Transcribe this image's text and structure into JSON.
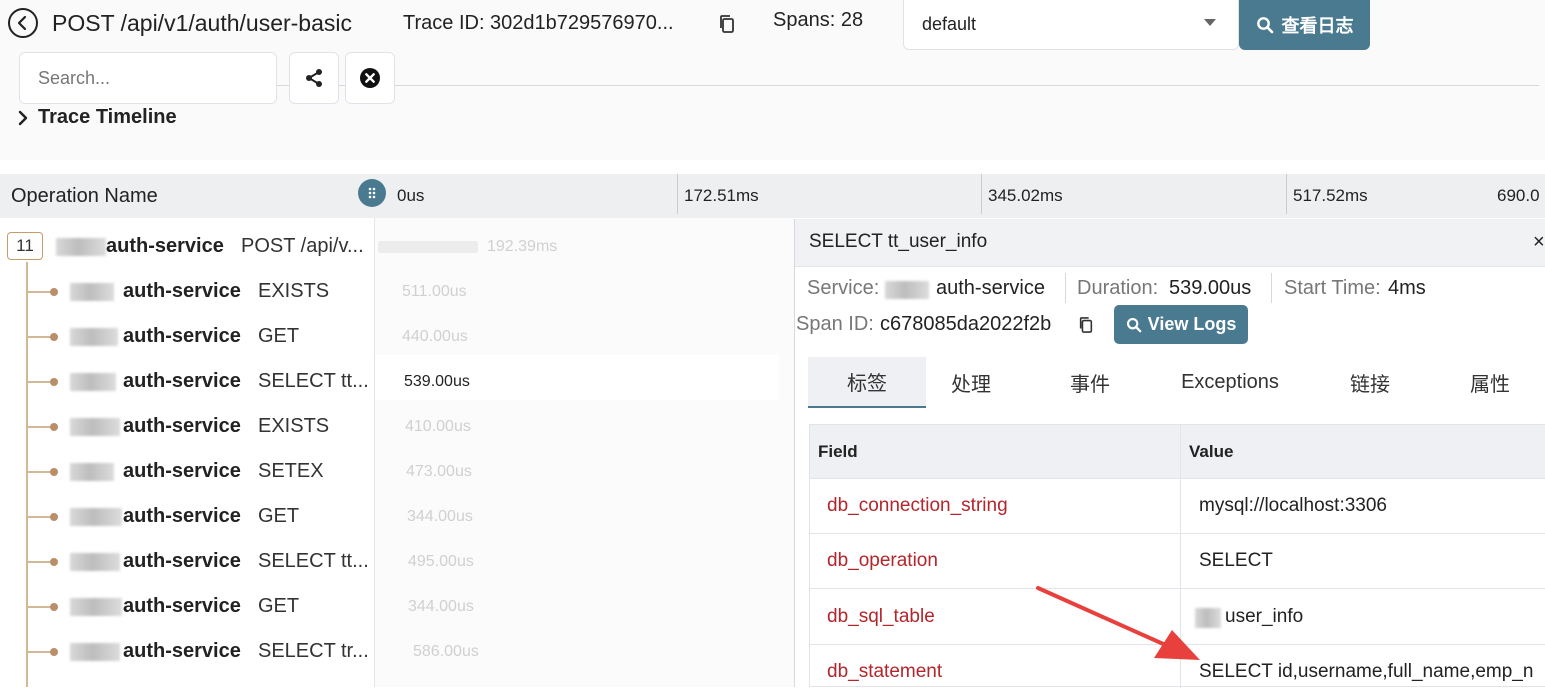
{
  "header": {
    "title": "POST /api/v1/auth/user-basic",
    "trace_id": "Trace ID: 302d1b729576970...",
    "spans": "Spans: 28",
    "namespace_select": "default",
    "query_logs_button": "查看日志",
    "search_placeholder": "Search...",
    "timeline_toggle": "Trace Timeline"
  },
  "columns": {
    "operation_name": "Operation Name",
    "ticks": [
      "0us",
      "172.51ms",
      "345.02ms",
      "517.52ms",
      "690.0"
    ]
  },
  "tree": {
    "root_badge": "11",
    "rows": [
      {
        "service": "auth-service",
        "operation": "POST /api/v...",
        "duration": "192.39ms"
      },
      {
        "service": "auth-service",
        "operation": "EXISTS",
        "duration": "511.00us"
      },
      {
        "service": "auth-service",
        "operation": "GET",
        "duration": "440.00us"
      },
      {
        "service": "auth-service",
        "operation": "SELECT tt...",
        "duration": "539.00us"
      },
      {
        "service": "auth-service",
        "operation": "EXISTS",
        "duration": "410.00us"
      },
      {
        "service": "auth-service",
        "operation": "SETEX",
        "duration": "473.00us"
      },
      {
        "service": "auth-service",
        "operation": "GET",
        "duration": "344.00us"
      },
      {
        "service": "auth-service",
        "operation": "SELECT tt...",
        "duration": "495.00us"
      },
      {
        "service": "auth-service",
        "operation": "GET",
        "duration": "344.00us"
      },
      {
        "service": "auth-service",
        "operation": "SELECT tr...",
        "duration": "586.00us"
      }
    ]
  },
  "detail": {
    "title": "SELECT tt_user_info",
    "close": "×",
    "service_label": "Service:",
    "service_value": "auth-service",
    "duration_label": "Duration:",
    "duration_value": "539.00us",
    "start_label": "Start Time:",
    "start_value": "4ms",
    "span_id_label": "Span ID:",
    "span_id_value": "c678085da2022f2b",
    "view_logs_button": "View Logs",
    "tabs": [
      "标签",
      "处理",
      "事件",
      "Exceptions",
      "链接",
      "属性"
    ],
    "table": {
      "field_header": "Field",
      "value_header": "Value",
      "rows": [
        {
          "field": "db_connection_string",
          "value": "mysql://localhost:3306"
        },
        {
          "field": "db_operation",
          "value": "SELECT"
        },
        {
          "field": "db_sql_table",
          "value": "user_info"
        },
        {
          "field": "db_statement",
          "value": "SELECT id,username,full_name,emp_n"
        }
      ]
    }
  },
  "colors": {
    "accent": "#4a7a90",
    "field_text": "#b3262b",
    "tree_line": "#d1b896",
    "annotation_arrow": "#e8403c"
  }
}
